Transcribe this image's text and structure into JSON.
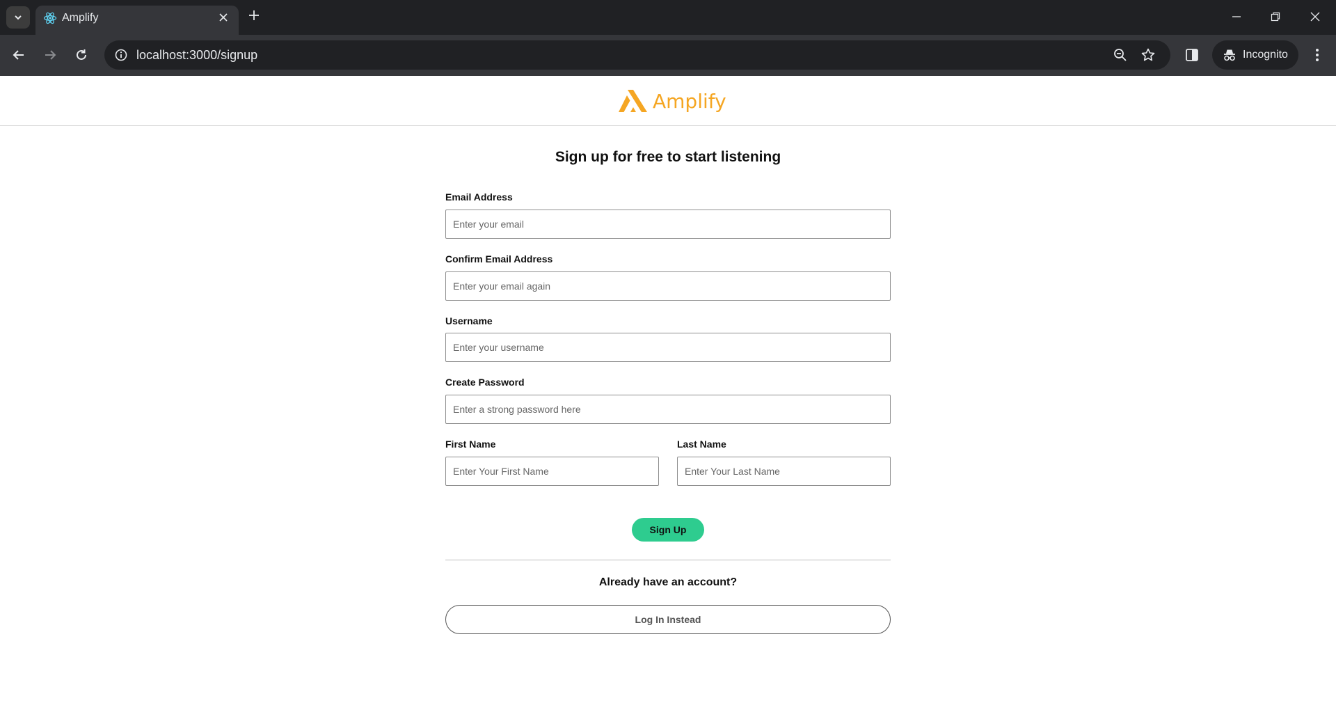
{
  "browser": {
    "tab_title": "Amplify",
    "url": "localhost:3000/signup",
    "profile_label": "Incognito",
    "icons": {
      "tab_search": "chevron-down-icon",
      "favicon": "react-icon",
      "tab_close": "close-icon",
      "new_tab": "plus-icon",
      "back": "arrow-left-icon",
      "forward": "arrow-right-icon",
      "reload": "reload-icon",
      "site_info": "info-icon",
      "zoom": "zoom-icon",
      "bookmark": "star-icon",
      "side_panel": "side-panel-icon",
      "incognito": "incognito-icon",
      "menu": "kebab-menu-icon"
    }
  },
  "header": {
    "brand_name": "Amplify",
    "brand_color": "#f5a623"
  },
  "signup": {
    "title": "Sign up for free to start listening",
    "fields": {
      "email": {
        "label": "Email Address",
        "placeholder": "Enter your email"
      },
      "confirm_email": {
        "label": "Confirm Email Address",
        "placeholder": "Enter your email again"
      },
      "username": {
        "label": "Username",
        "placeholder": "Enter your username"
      },
      "password": {
        "label": "Create Password",
        "placeholder": "Enter a strong password here"
      },
      "first_name": {
        "label": "First Name",
        "placeholder": "Enter Your First Name"
      },
      "last_name": {
        "label": "Last Name",
        "placeholder": "Enter Your Last Name"
      }
    },
    "submit_label": "Sign Up",
    "submit_color": "#2ecc8f",
    "have_account_text": "Already have an account?",
    "login_label": "Log In Instead"
  }
}
